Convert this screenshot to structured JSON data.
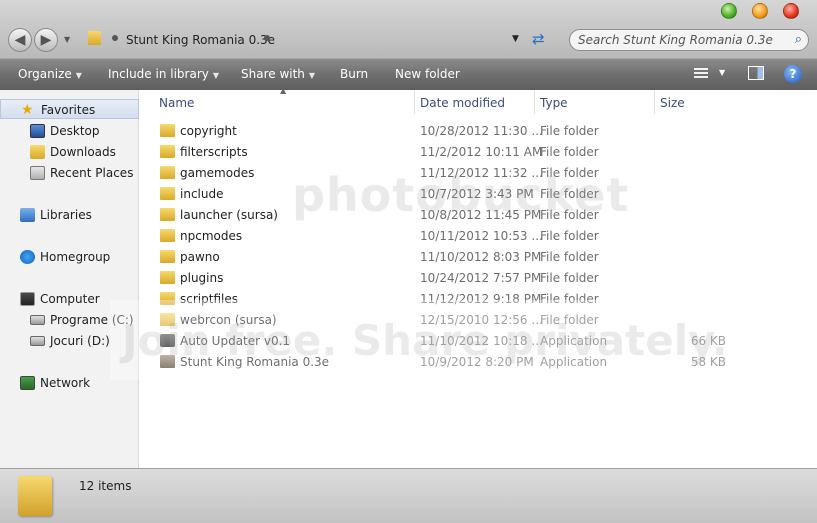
{
  "window": {
    "path": "Stunt King Romania 0.3e",
    "search_placeholder": "Search Stunt King Romania 0.3e"
  },
  "toolbar": {
    "organize": "Organize",
    "include_in_library": "Include in library",
    "share_with": "Share with",
    "burn": "Burn",
    "new_folder": "New folder"
  },
  "sidebar": {
    "favorites": "Favorites",
    "desktop": "Desktop",
    "downloads": "Downloads",
    "recent_places": "Recent Places",
    "libraries": "Libraries",
    "homegroup": "Homegroup",
    "computer": "Computer",
    "drive_c": "Programe (C:)",
    "drive_d": "Jocuri (D:)",
    "network": "Network"
  },
  "columns": {
    "name": "Name",
    "date_modified": "Date modified",
    "type": "Type",
    "size": "Size"
  },
  "files": [
    {
      "name": "copyright",
      "date": "10/28/2012 11:30 ...",
      "type": "File folder",
      "size": "",
      "icon": "folder"
    },
    {
      "name": "filterscripts",
      "date": "11/2/2012 10:11 AM",
      "type": "File folder",
      "size": "",
      "icon": "folder"
    },
    {
      "name": "gamemodes",
      "date": "11/12/2012 11:32 ...",
      "type": "File folder",
      "size": "",
      "icon": "folder"
    },
    {
      "name": "include",
      "date": "10/7/2012 3:43 PM",
      "type": "File folder",
      "size": "",
      "icon": "folder"
    },
    {
      "name": "launcher (sursa)",
      "date": "10/8/2012 11:45 PM",
      "type": "File folder",
      "size": "",
      "icon": "folder"
    },
    {
      "name": "npcmodes",
      "date": "10/11/2012 10:53 ...",
      "type": "File folder",
      "size": "",
      "icon": "folder"
    },
    {
      "name": "pawno",
      "date": "11/10/2012 8:03 PM",
      "type": "File folder",
      "size": "",
      "icon": "folder"
    },
    {
      "name": "plugins",
      "date": "10/24/2012 7:57 PM",
      "type": "File folder",
      "size": "",
      "icon": "folder"
    },
    {
      "name": "scriptfiles",
      "date": "11/12/2012 9:18 PM",
      "type": "File folder",
      "size": "",
      "icon": "folder"
    },
    {
      "name": "webrcon (sursa)",
      "date": "12/15/2010 12:56 ...",
      "type": "File folder",
      "size": "",
      "icon": "folder"
    },
    {
      "name": "Auto Updater v0.1",
      "date": "11/10/2012 10:18 ...",
      "type": "Application",
      "size": "66 KB",
      "icon": "app"
    },
    {
      "name": "Stunt King Romania 0.3e",
      "date": "10/9/2012 8:20 PM",
      "type": "Application",
      "size": "58 KB",
      "icon": "app2"
    }
  ],
  "status": {
    "count": "12 items"
  },
  "watermark": {
    "line1": "photobucket",
    "line2": "Join free. Share privately."
  }
}
